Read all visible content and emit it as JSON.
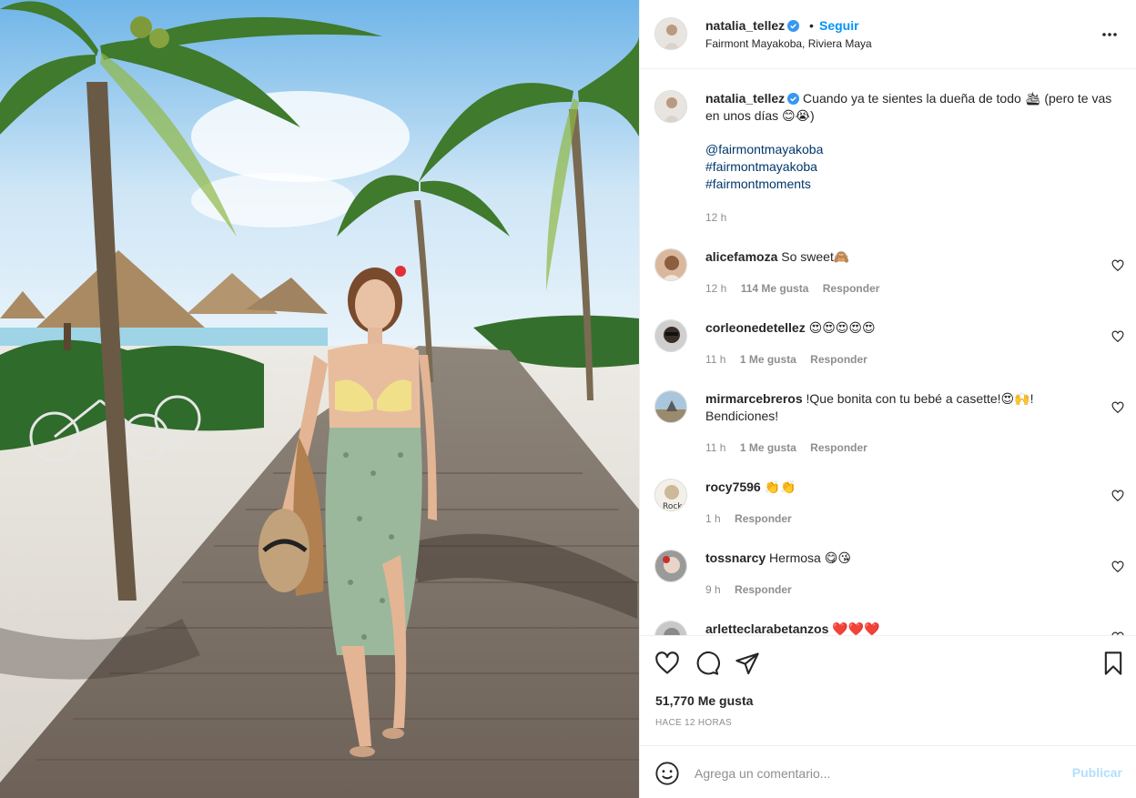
{
  "header": {
    "username": "natalia_tellez",
    "dot": "•",
    "follow_label": "Seguir",
    "location": "Fairmont Mayakoba, Riviera Maya"
  },
  "caption": {
    "username": "natalia_tellez",
    "text": "Cuando ya te sientes la dueña de todo 🛳 (pero te vas en unos días 😊😭)",
    "mention": "@fairmontmayakoba",
    "hashtags": [
      "#fairmontmayakoba",
      "#fairmontmoments"
    ],
    "time": "12 h"
  },
  "comments": [
    {
      "username": "alicefamoza",
      "text": "So sweet🙈",
      "time": "12 h",
      "likes": "114 Me gusta",
      "reply": "Responder"
    },
    {
      "username": "corleonedetellez",
      "text": "😍😍😍😍😍",
      "time": "11 h",
      "likes": "1 Me gusta",
      "reply": "Responder"
    },
    {
      "username": "mirmarcebreros",
      "text": "!Que bonita con tu bebé a casette!😍🙌! Bendiciones!",
      "time": "11 h",
      "likes": "1 Me gusta",
      "reply": "Responder"
    },
    {
      "username": "rocy7596",
      "text": "👏👏",
      "time": "1 h",
      "likes": "",
      "reply": "Responder"
    },
    {
      "username": "tossnarcy",
      "text": "Hermosa 😋😘",
      "time": "9 h",
      "likes": "",
      "reply": "Responder"
    },
    {
      "username": "arletteclarabetanzos",
      "text": "❤️❤️❤️",
      "time": "",
      "likes": "",
      "reply": ""
    }
  ],
  "actions": {
    "likes_count": "51,770 Me gusta",
    "time_ago": "HACE 12 HORAS"
  },
  "add_comment": {
    "placeholder": "Agrega un comentario...",
    "publish_label": "Publicar"
  },
  "icons": {
    "more": "more-horizontal-icon",
    "like": "heart-icon",
    "comment": "comment-bubble-icon",
    "share": "paper-plane-icon",
    "save": "bookmark-icon",
    "emoji": "smiley-face-icon",
    "verified": "verified-badge-icon"
  },
  "colors": {
    "link_blue": "#0095f6",
    "publish_disabled": "#b2dffc",
    "verified": "#3897f0",
    "secondary_text": "#8e8e8e"
  }
}
